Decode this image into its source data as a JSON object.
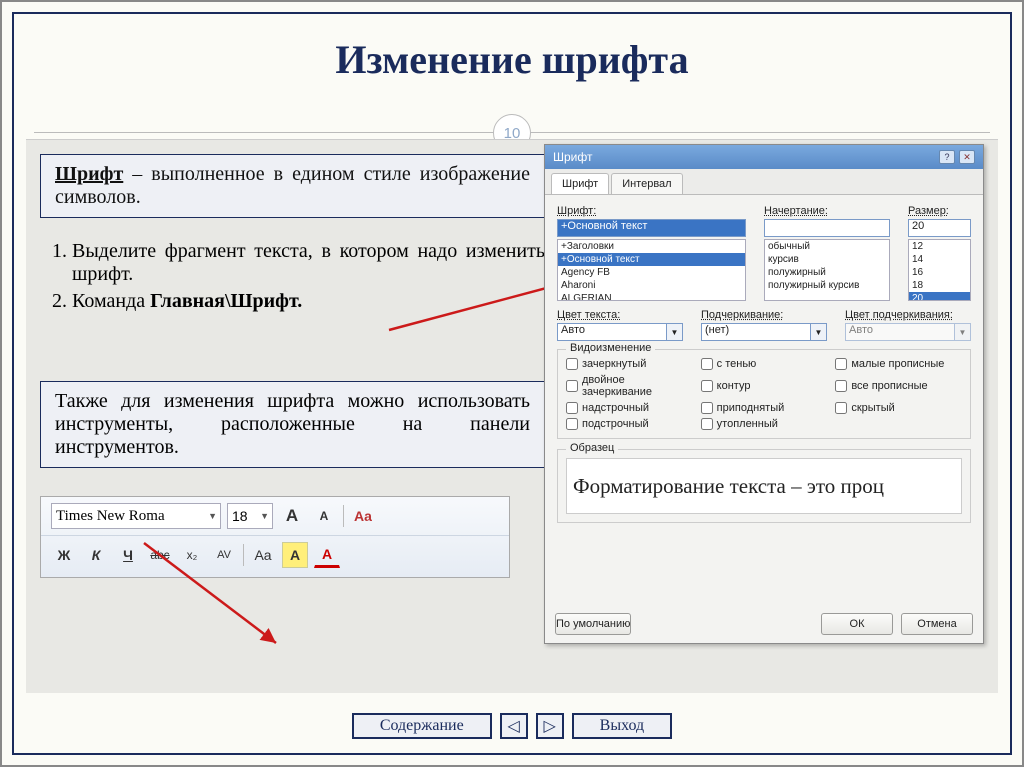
{
  "page": {
    "title": "Изменение шрифта",
    "number": "10"
  },
  "definition": {
    "term": "Шрифт",
    "text": " – выполненное в едином стиле изображение символов."
  },
  "steps": {
    "s1": "Выделите фрагмент текста, в котором надо изменить шрифт.",
    "s2_pre": "Команда ",
    "s2_bold": "Главная\\Шрифт."
  },
  "also": "Также для изменения шрифта можно использовать инструменты, расположенные на панели инструментов.",
  "toolbar": {
    "font_name": "Times New Roma",
    "font_size": "18",
    "grow": "A",
    "shrink": "A",
    "clear": "Aa",
    "bold": "Ж",
    "italic": "К",
    "underline": "Ч",
    "strike": "abc",
    "subsup": "x₂",
    "av": "AV",
    "case": "Aa",
    "highlight": "A",
    "fontcolor": "A"
  },
  "dialog": {
    "title": "Шрифт",
    "tabs": {
      "font": "Шрифт",
      "interval": "Интервал"
    },
    "labels": {
      "font": "Шрифт:",
      "style": "Начертание:",
      "size": "Размер:",
      "color": "Цвет текста:",
      "underline": "Подчеркивание:",
      "ucolor": "Цвет подчеркивания:",
      "effects": "Видоизменение",
      "preview": "Образец"
    },
    "font_value": "+Основной текст",
    "font_list": [
      "+Заголовки",
      "+Основной текст",
      "Agency FB",
      "Aharoni",
      "ALGERIAN"
    ],
    "style_list": [
      "обычный",
      "курсив",
      "полужирный",
      "полужирный курсив"
    ],
    "size_value": "20",
    "size_list": [
      "12",
      "14",
      "16",
      "18",
      "20"
    ],
    "color": "Авто",
    "underline": "(нет)",
    "ucolor": "Авто",
    "effects": {
      "strike": "зачеркнутый",
      "dstrike": "двойное зачеркивание",
      "super": "надстрочный",
      "sub": "подстрочный",
      "shadow": "с тенью",
      "outline": "контур",
      "raised": "приподнятый",
      "sunken": "утопленный",
      "smallcaps": "малые прописные",
      "allcaps": "все прописные",
      "hidden": "скрытый"
    },
    "preview": "Форматирование текста – это проц",
    "buttons": {
      "default": "По умолчанию",
      "ok": "ОК",
      "cancel": "Отмена"
    },
    "help": "?",
    "close": "✕"
  },
  "nav": {
    "contents": "Содержание",
    "exit": "Выход"
  }
}
